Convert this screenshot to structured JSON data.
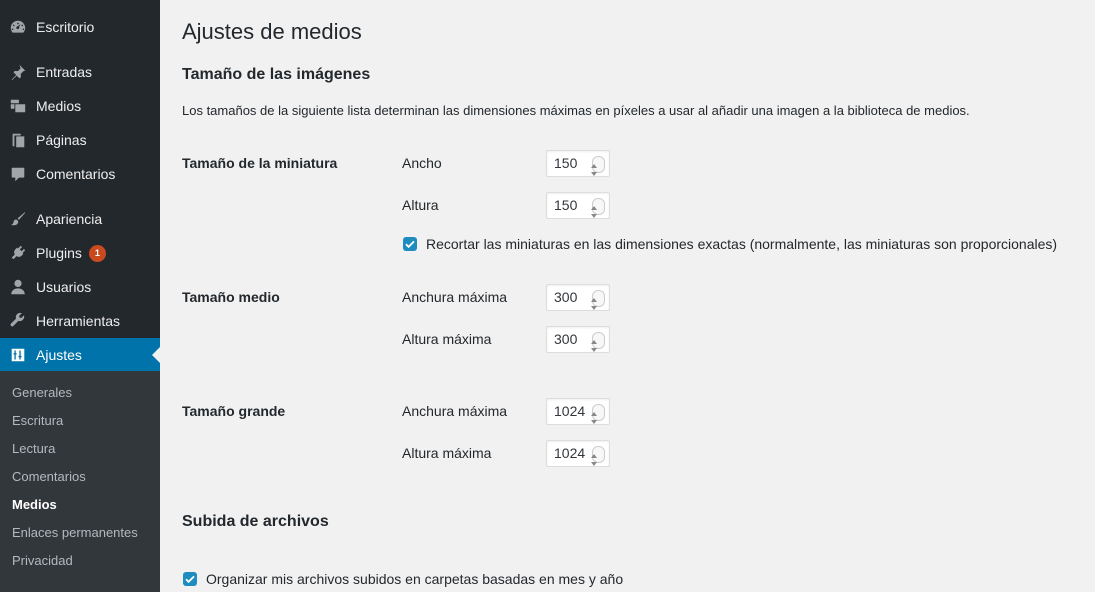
{
  "sidebar": {
    "items": [
      {
        "label": "Escritorio",
        "icon": "dashboard-icon"
      },
      {
        "label": "Entradas",
        "icon": "pin-icon"
      },
      {
        "label": "Medios",
        "icon": "media-icon"
      },
      {
        "label": "Páginas",
        "icon": "page-icon"
      },
      {
        "label": "Comentarios",
        "icon": "comment-icon"
      },
      {
        "label": "Apariencia",
        "icon": "brush-icon"
      },
      {
        "label": "Plugins",
        "icon": "plugin-icon",
        "badge": "1"
      },
      {
        "label": "Usuarios",
        "icon": "user-icon"
      },
      {
        "label": "Herramientas",
        "icon": "wrench-icon"
      },
      {
        "label": "Ajustes",
        "icon": "settings-icon",
        "active": true
      }
    ],
    "submenu": [
      {
        "label": "Generales"
      },
      {
        "label": "Escritura"
      },
      {
        "label": "Lectura"
      },
      {
        "label": "Comentarios"
      },
      {
        "label": "Medios",
        "current": true
      },
      {
        "label": "Enlaces permanentes"
      },
      {
        "label": "Privacidad"
      }
    ]
  },
  "main": {
    "title": "Ajustes de medios",
    "image_sizes": {
      "heading": "Tamaño de las imágenes",
      "description": "Los tamaños de la siguiente lista determinan las dimensiones máximas en píxeles a usar al añadir una imagen a la biblioteca de medios.",
      "thumbnail": {
        "label": "Tamaño de la miniatura",
        "width_label": "Ancho",
        "width_value": "150",
        "height_label": "Altura",
        "height_value": "150",
        "crop_label": "Recortar las miniaturas en las dimensiones exactas (normalmente, las miniaturas son proporcionales)",
        "crop_checked": true
      },
      "medium": {
        "label": "Tamaño medio",
        "width_label": "Anchura máxima",
        "width_value": "300",
        "height_label": "Altura máxima",
        "height_value": "300"
      },
      "large": {
        "label": "Tamaño grande",
        "width_label": "Anchura máxima",
        "width_value": "1024",
        "height_label": "Altura máxima",
        "height_value": "1024"
      }
    },
    "uploads": {
      "heading": "Subida de archivos",
      "organize_label": "Organizar mis archivos subidos en carpetas basadas en mes y año",
      "organize_checked": true
    }
  },
  "colors": {
    "sidebar_bg": "#23282d",
    "submenu_bg": "#32373c",
    "accent": "#0073aa",
    "checkbox": "#1e8cbe",
    "badge": "#ca4a1f",
    "page_bg": "#f1f1f1"
  }
}
